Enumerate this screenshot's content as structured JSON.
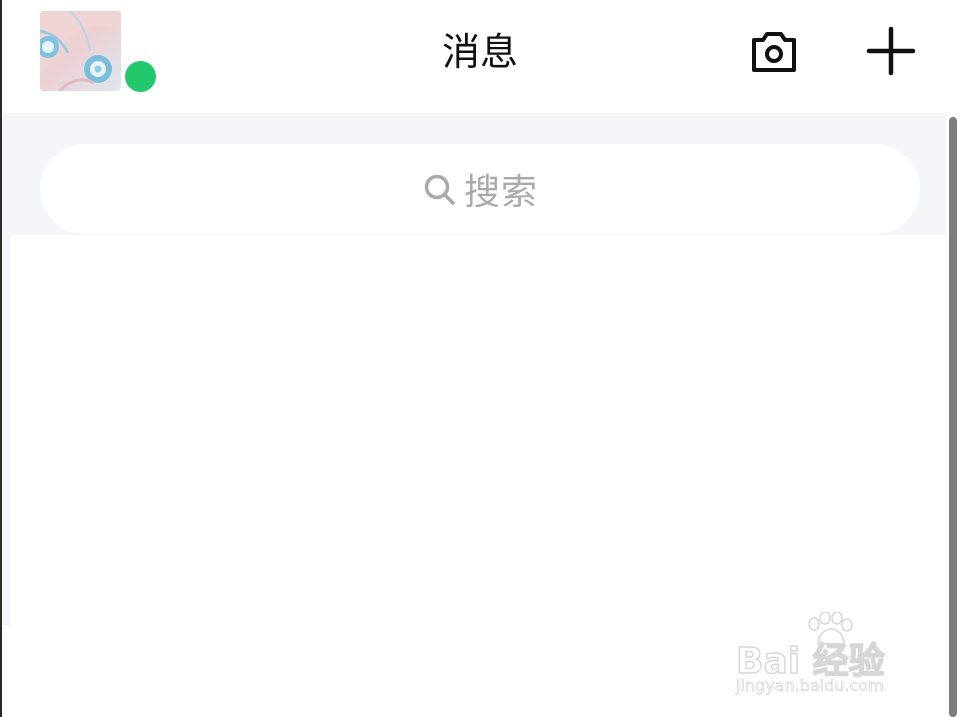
{
  "header": {
    "title": "消息",
    "avatar_icon": "user-avatar",
    "status_color": "#22c96c",
    "camera_icon": "camera-icon",
    "add_icon": "plus-icon"
  },
  "search": {
    "placeholder": "搜索",
    "icon": "search-icon"
  },
  "watermark": {
    "brand": "Bai  经验",
    "url": "jingyan.baidu.com"
  },
  "colors": {
    "band_background": "#f4f5f9",
    "placeholder_text": "#a9aab1",
    "title_text": "#111111"
  }
}
